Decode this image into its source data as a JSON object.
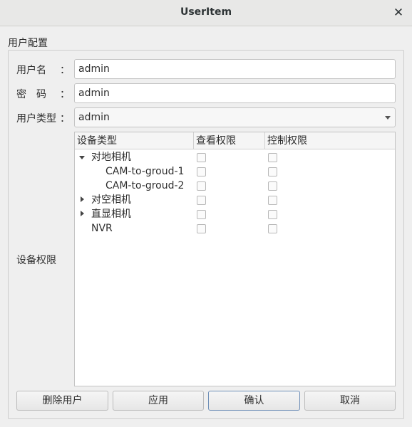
{
  "window": {
    "title": "UserItem"
  },
  "group": {
    "title": "用户配置"
  },
  "form": {
    "username_label": "用户名",
    "password_label": "密　码",
    "usertype_label": "用户类型",
    "colon": "：",
    "username_value": "admin",
    "password_value": "admin",
    "usertype_value": "admin"
  },
  "permissions": {
    "label": "设备权限",
    "columns": [
      "设备类型",
      "查看权限",
      "控制权限"
    ],
    "rows": [
      {
        "label": "对地相机",
        "expanded": true,
        "view": false,
        "control": false
      },
      {
        "label": "CAM-to-groud-1",
        "view": false,
        "control": false
      },
      {
        "label": "CAM-to-groud-2",
        "view": false,
        "control": false
      },
      {
        "label": "对空相机",
        "expanded": false,
        "view": false,
        "control": false
      },
      {
        "label": "直显相机",
        "expanded": false,
        "view": false,
        "control": false
      },
      {
        "label": "NVR",
        "view": false,
        "control": false
      }
    ]
  },
  "buttons": {
    "delete": "删除用户",
    "apply": "应用",
    "ok": "确认",
    "cancel": "取消"
  },
  "icons": {
    "close": "close-icon",
    "dropdown": "chevron-down-icon",
    "expand": "chevron-right-icon",
    "collapse": "chevron-down-icon"
  }
}
